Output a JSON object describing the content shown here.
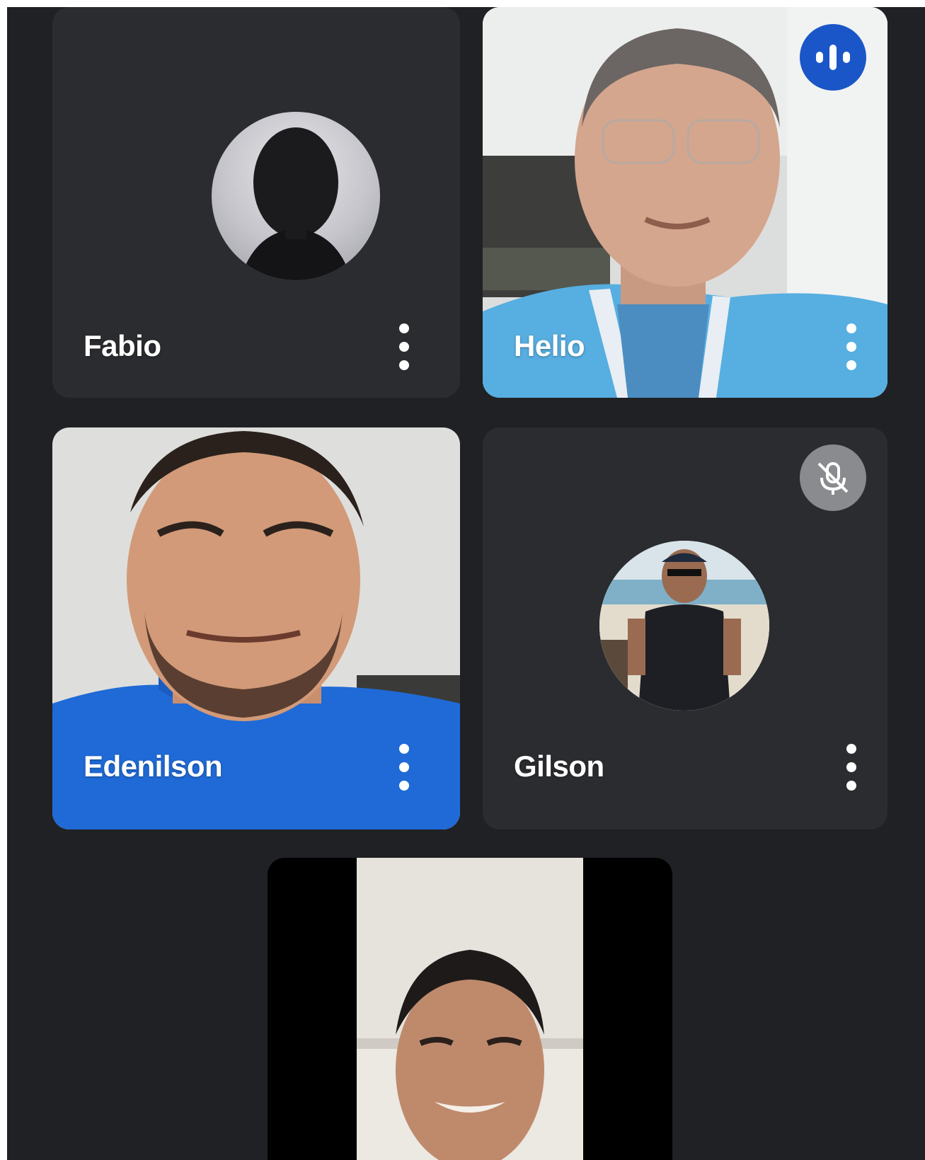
{
  "participants": [
    {
      "name": "Fabio",
      "video": false
    },
    {
      "name": "Helio",
      "video": true,
      "speaking": true
    },
    {
      "name": "Edenilson",
      "video": true
    },
    {
      "name": "Gilson",
      "video": false,
      "muted": true
    },
    {
      "name": "",
      "video": true
    }
  ],
  "icons": {
    "speaking": "audio-levels-icon",
    "muted": "mic-off-icon",
    "options": "more-vert-icon"
  },
  "colors": {
    "background": "#202124",
    "tile": "#2b2c30",
    "speaking_badge": "#1a56c8",
    "muted_badge": "#8a8b8f"
  }
}
